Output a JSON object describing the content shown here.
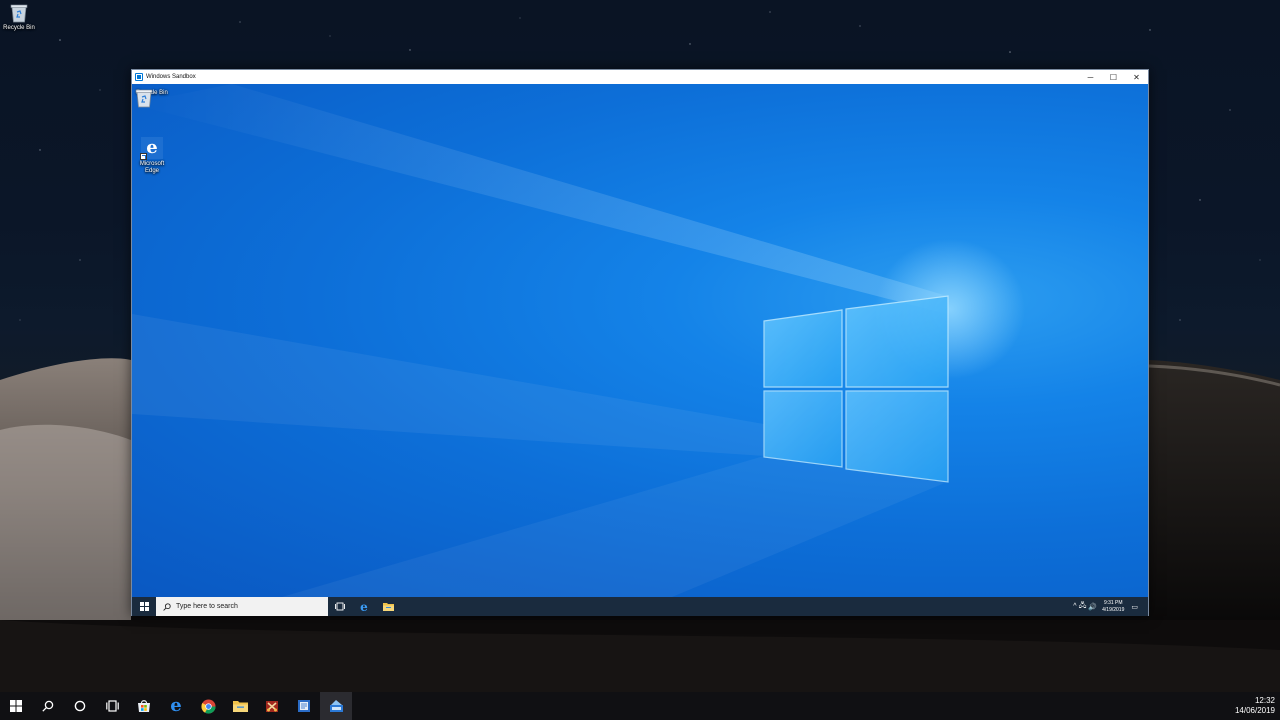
{
  "host_desktop": {
    "icons": [
      {
        "label": "Recycle Bin",
        "icon": "recycle-bin-icon"
      }
    ]
  },
  "sandbox_window": {
    "title": "Windows Sandbox",
    "controls": {
      "minimize": "─",
      "maximize": "☐",
      "close": "✕"
    },
    "desktop_icons": [
      {
        "label": "Recycle Bin",
        "icon": "recycle-bin-icon"
      },
      {
        "label_line1": "Microsoft",
        "label_line2": "Edge",
        "icon": "edge-icon"
      }
    ],
    "taskbar": {
      "search_placeholder": "Type here to search",
      "pinned": [
        "task-view-icon",
        "edge-icon",
        "file-explorer-icon"
      ],
      "clock_time": "9:31 PM",
      "clock_date": "4/19/2019",
      "tray_chevron": "^",
      "tray_network": "🖧",
      "tray_volume": "🔊",
      "tray_notifications": "▭"
    }
  },
  "host_taskbar": {
    "pinned": [
      "windows-start-icon",
      "search-icon",
      "cortana-icon",
      "task-view-icon",
      "store-icon",
      "edge-icon",
      "chrome-icon",
      "file-explorer-icon",
      "snipping-app-icon",
      "notepad-app-icon",
      "sandbox-app-icon"
    ],
    "clock_time": "12:32",
    "clock_date": "14/06/2019"
  },
  "colors": {
    "sandbox_taskbar": "#1a2b3e",
    "host_taskbar": "#101013",
    "win10_blue": "#0d6fd8",
    "edge_blue": "#1d6fd1"
  }
}
